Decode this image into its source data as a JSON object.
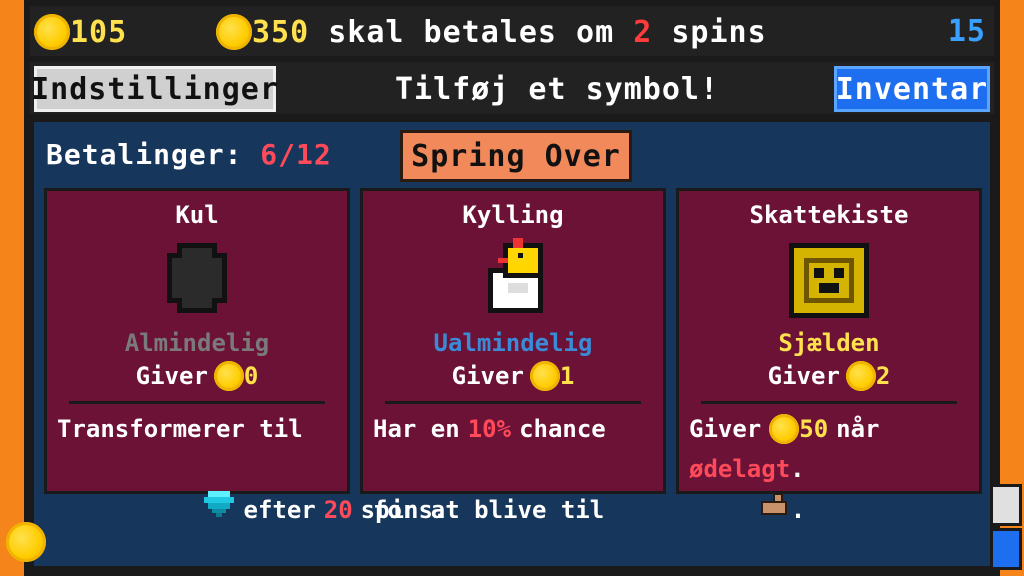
{
  "topbar": {
    "coins": "105",
    "due_amount": "350",
    "due_text_1": "skal betales om",
    "due_spins": "2",
    "due_text_2": "spins",
    "round": "15"
  },
  "nav": {
    "settings_label": "Indstillinger",
    "title": "Tilføj et symbol!",
    "inventory_label": "Inventar"
  },
  "payments": {
    "label": "Betalinger:",
    "value": "6/12"
  },
  "skip_button": "Spring Over",
  "cards": [
    {
      "name": "Kul",
      "rarity": "Almindelig",
      "gives_label": "Giver",
      "gives_value": "0",
      "desc_l1": "Transformerer til",
      "desc_l2a": "efter",
      "desc_l2b": "20",
      "desc_l2c": "spins.",
      "icon": "coal-icon",
      "desc_icon": "diamond-icon"
    },
    {
      "name": "Kylling",
      "rarity": "Ualmindelig",
      "gives_label": "Giver",
      "gives_value": "1",
      "desc_l1a": "Har en",
      "desc_l1b": "10%",
      "desc_l1c": "chance",
      "desc_l2": "for at blive til",
      "desc_l2end": ".",
      "icon": "chicken-icon",
      "desc_icon": "chick-icon"
    },
    {
      "name": "Skattekiste",
      "rarity": "Sjælden",
      "gives_label": "Giver",
      "gives_value": "2",
      "desc_l1a": "Giver",
      "desc_l1b": "50",
      "desc_l1c": "når",
      "desc_l2": "ødelagt",
      "desc_l2end": ".",
      "icon": "treasure-chest-icon"
    }
  ],
  "colors": {
    "background": "#f5851b",
    "panel": "#17365c",
    "card": "#6b1236",
    "accent_red": "#ff4a5a",
    "coin_yellow": "#ffe14d"
  }
}
